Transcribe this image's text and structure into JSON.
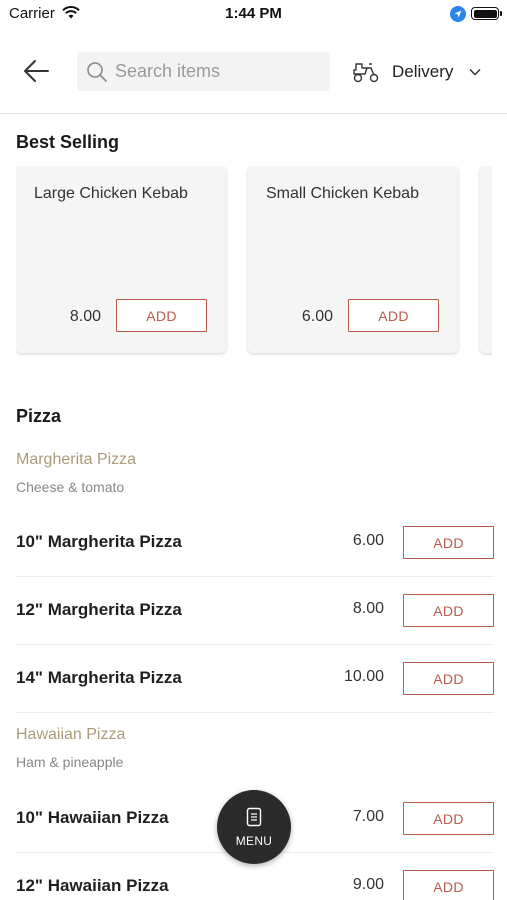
{
  "status_bar": {
    "carrier": "Carrier",
    "time": "1:44 PM"
  },
  "header": {
    "search_placeholder": "Search items",
    "delivery_label": "Delivery"
  },
  "best_selling": {
    "title": "Best Selling",
    "items": [
      {
        "name": "Large Chicken Kebab",
        "price": "8.00",
        "add_label": "ADD"
      },
      {
        "name": "Small Chicken Kebab",
        "price": "6.00",
        "add_label": "ADD"
      }
    ]
  },
  "pizza": {
    "title": "Pizza",
    "groups": [
      {
        "name": "Margherita Pizza",
        "description": "Cheese & tomato",
        "items": [
          {
            "name": "10\" Margherita Pizza",
            "price": "6.00",
            "add_label": "ADD"
          },
          {
            "name": "12\" Margherita Pizza",
            "price": "8.00",
            "add_label": "ADD"
          },
          {
            "name": "14\" Margherita Pizza",
            "price": "10.00",
            "add_label": "ADD"
          }
        ]
      },
      {
        "name": "Hawaiian Pizza",
        "description": "Ham & pineapple",
        "items": [
          {
            "name": "10\" Hawaiian Pizza",
            "price": "7.00",
            "add_label": "ADD"
          },
          {
            "name": "12\" Hawaiian Pizza",
            "price": "9.00",
            "add_label": "ADD"
          }
        ]
      }
    ]
  },
  "menu_fab": {
    "label": "MENU"
  },
  "colors": {
    "accent": "#b85c4a",
    "subcategory": "#a89c78",
    "fab": "#2b2b2b"
  }
}
